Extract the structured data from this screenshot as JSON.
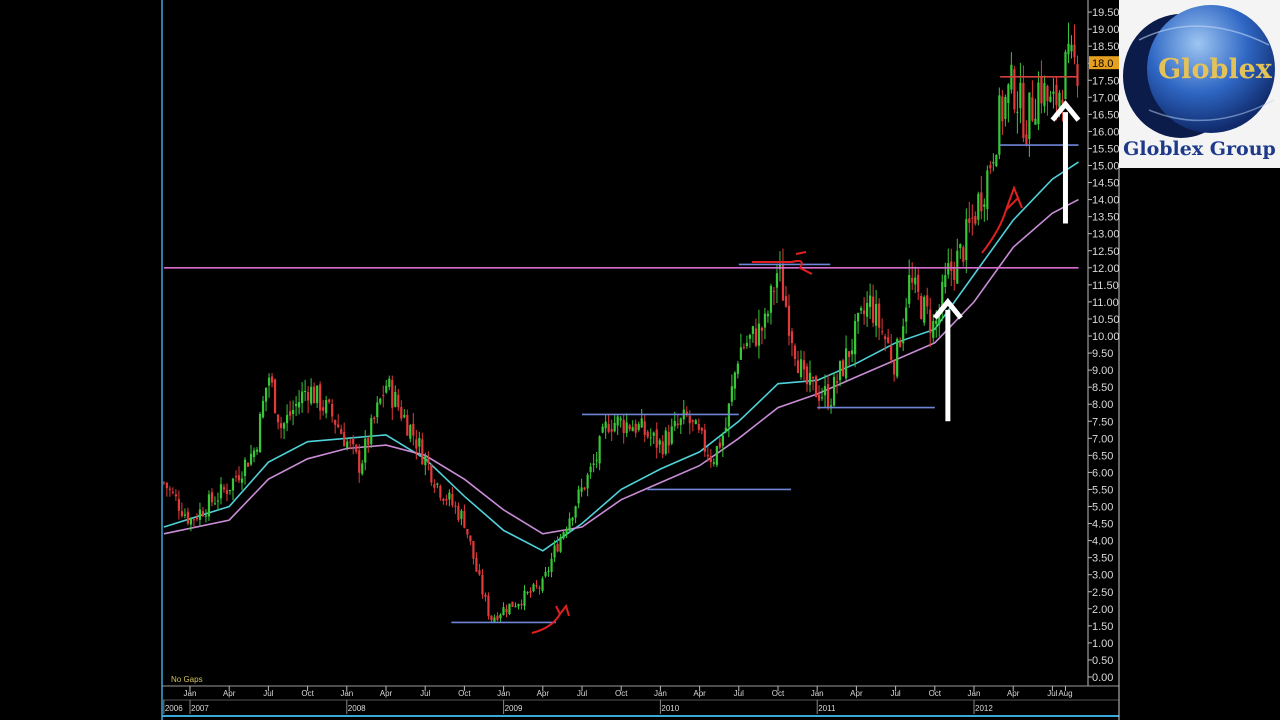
{
  "logo": {
    "brand_in_globe": "Globlex",
    "caption": "Globlex Group"
  },
  "status": {
    "no_gaps": "No Gaps"
  },
  "current_price_label": "18.0",
  "chart_data": {
    "type": "line",
    "title": "",
    "xlabel": "",
    "ylabel": "",
    "ylim": [
      0,
      19.5
    ],
    "y_ticks": [
      "0.00",
      "0.50",
      "1.00",
      "1.50",
      "2.00",
      "2.50",
      "3.00",
      "3.50",
      "4.00",
      "4.50",
      "5.00",
      "5.50",
      "6.00",
      "6.50",
      "7.00",
      "7.50",
      "8.00",
      "8.50",
      "9.00",
      "9.50",
      "10.00",
      "10.50",
      "11.00",
      "11.50",
      "12.00",
      "12.50",
      "13.00",
      "13.50",
      "14.00",
      "14.50",
      "15.00",
      "15.50",
      "16.00",
      "16.50",
      "17.00",
      "17.50",
      "18.00",
      "18.50",
      "19.00",
      "19.50"
    ],
    "month_ticks": [
      [
        "Jan",
        "2007-01"
      ],
      [
        "Apr",
        "2007-04"
      ],
      [
        "Jul",
        "2007-07"
      ],
      [
        "Oct",
        "2007-10"
      ],
      [
        "Jan",
        "2008-01"
      ],
      [
        "Apr",
        "2008-04"
      ],
      [
        "Jul",
        "2008-07"
      ],
      [
        "Oct",
        "2008-10"
      ],
      [
        "Jan",
        "2009-01"
      ],
      [
        "Apr",
        "2009-04"
      ],
      [
        "Jul",
        "2009-07"
      ],
      [
        "Oct",
        "2009-10"
      ],
      [
        "Jan",
        "2010-01"
      ],
      [
        "Apr",
        "2010-04"
      ],
      [
        "Jul",
        "2010-07"
      ],
      [
        "Oct",
        "2010-10"
      ],
      [
        "Jan",
        "2011-01"
      ],
      [
        "Apr",
        "2011-04"
      ],
      [
        "Jul",
        "2011-07"
      ],
      [
        "Oct",
        "2011-10"
      ],
      [
        "Jan",
        "2012-01"
      ],
      [
        "Apr",
        "2012-04"
      ],
      [
        "Jul",
        "2012-07"
      ],
      [
        "Aug",
        "2012-08"
      ]
    ],
    "year_ticks": [
      [
        "2006",
        "2006-11"
      ],
      [
        "2007",
        "2007-01"
      ],
      [
        "2008",
        "2008-01"
      ],
      [
        "2009",
        "2009-01"
      ],
      [
        "2010",
        "2010-01"
      ],
      [
        "2011",
        "2011-01"
      ],
      [
        "2012",
        "2012-01"
      ]
    ],
    "x_range": [
      "2006-11",
      "2012-09"
    ],
    "price_path": [
      [
        "2006-11",
        5.7
      ],
      [
        "2007-01",
        4.6
      ],
      [
        "2007-04",
        5.6
      ],
      [
        "2007-06",
        6.7
      ],
      [
        "2007-07",
        8.9
      ],
      [
        "2007-08",
        7.3
      ],
      [
        "2007-10",
        8.5
      ],
      [
        "2007-12",
        7.6
      ],
      [
        "2008-02",
        6.2
      ],
      [
        "2008-04",
        8.6
      ],
      [
        "2008-06",
        7.2
      ],
      [
        "2008-08",
        5.6
      ],
      [
        "2008-10",
        4.6
      ],
      [
        "2008-11",
        3.0
      ],
      [
        "2008-12",
        1.7
      ],
      [
        "2009-01",
        2.0
      ],
      [
        "2009-02",
        2.2
      ],
      [
        "2009-04",
        2.7
      ],
      [
        "2009-05",
        3.8
      ],
      [
        "2009-06",
        4.7
      ],
      [
        "2009-08",
        6.3
      ],
      [
        "2009-09",
        7.5
      ],
      [
        "2009-11",
        7.4
      ],
      [
        "2010-01",
        6.8
      ],
      [
        "2010-03",
        7.6
      ],
      [
        "2010-05",
        6.4
      ],
      [
        "2010-06",
        7.3
      ],
      [
        "2010-07",
        9.6
      ],
      [
        "2010-09",
        10.3
      ],
      [
        "2010-10",
        12.0
      ],
      [
        "2010-11",
        10.2
      ],
      [
        "2010-12",
        8.6
      ],
      [
        "2011-02",
        8.2
      ],
      [
        "2011-04",
        10.1
      ],
      [
        "2011-05",
        11.0
      ],
      [
        "2011-07",
        9.2
      ],
      [
        "2011-08",
        11.6
      ],
      [
        "2011-10",
        10.2
      ],
      [
        "2011-11",
        11.8
      ],
      [
        "2011-12",
        12.4
      ],
      [
        "2012-02",
        14.7
      ],
      [
        "2012-03",
        16.5
      ],
      [
        "2012-04",
        17.4
      ],
      [
        "2012-05",
        16.2
      ],
      [
        "2012-06",
        17.4
      ],
      [
        "2012-07",
        16.6
      ],
      [
        "2012-08",
        17.8
      ],
      [
        "2012-09",
        18.0
      ]
    ],
    "moving_averages": [
      {
        "color": "#4fd1d9",
        "points": [
          [
            "2006-11",
            4.4
          ],
          [
            "2007-04",
            5.0
          ],
          [
            "2007-07",
            6.3
          ],
          [
            "2007-10",
            6.9
          ],
          [
            "2008-01",
            7.0
          ],
          [
            "2008-04",
            7.1
          ],
          [
            "2008-07",
            6.4
          ],
          [
            "2008-10",
            5.3
          ],
          [
            "2009-01",
            4.3
          ],
          [
            "2009-04",
            3.7
          ],
          [
            "2009-07",
            4.5
          ],
          [
            "2009-10",
            5.5
          ],
          [
            "2010-01",
            6.1
          ],
          [
            "2010-04",
            6.6
          ],
          [
            "2010-07",
            7.5
          ],
          [
            "2010-10",
            8.6
          ],
          [
            "2011-01",
            8.7
          ],
          [
            "2011-04",
            9.2
          ],
          [
            "2011-07",
            9.8
          ],
          [
            "2011-10",
            10.2
          ],
          [
            "2012-01",
            11.8
          ],
          [
            "2012-04",
            13.4
          ],
          [
            "2012-07",
            14.6
          ],
          [
            "2012-09",
            15.1
          ]
        ]
      },
      {
        "color": "#c98cd6",
        "points": [
          [
            "2006-11",
            4.2
          ],
          [
            "2007-04",
            4.6
          ],
          [
            "2007-07",
            5.8
          ],
          [
            "2007-10",
            6.4
          ],
          [
            "2008-01",
            6.7
          ],
          [
            "2008-04",
            6.8
          ],
          [
            "2008-07",
            6.5
          ],
          [
            "2008-10",
            5.8
          ],
          [
            "2009-01",
            4.9
          ],
          [
            "2009-04",
            4.2
          ],
          [
            "2009-07",
            4.4
          ],
          [
            "2009-10",
            5.2
          ],
          [
            "2010-01",
            5.7
          ],
          [
            "2010-04",
            6.2
          ],
          [
            "2010-07",
            7.0
          ],
          [
            "2010-10",
            7.9
          ],
          [
            "2011-01",
            8.3
          ],
          [
            "2011-04",
            8.8
          ],
          [
            "2011-07",
            9.3
          ],
          [
            "2011-10",
            9.8
          ],
          [
            "2012-01",
            11.0
          ],
          [
            "2012-04",
            12.6
          ],
          [
            "2012-07",
            13.6
          ],
          [
            "2012-09",
            14.0
          ]
        ]
      }
    ],
    "annotations": {
      "horizontal_lines": [
        {
          "y": 12.0,
          "from": "2006-11",
          "to": "2012-09",
          "color": "#d86fd0",
          "note": "resistance line"
        },
        {
          "y": 1.6,
          "from": "2008-09",
          "to": "2009-05",
          "color": "#6f86d8"
        },
        {
          "y": 7.7,
          "from": "2009-07",
          "to": "2010-07",
          "color": "#6f86d8"
        },
        {
          "y": 5.5,
          "from": "2009-12",
          "to": "2010-11",
          "color": "#6f86d8"
        },
        {
          "y": 12.1,
          "from": "2010-07",
          "to": "2011-02",
          "color": "#6f86d8"
        },
        {
          "y": 7.9,
          "from": "2011-01",
          "to": "2011-10",
          "color": "#6f86d8"
        },
        {
          "y": 15.6,
          "from": "2012-03",
          "to": "2012-09",
          "color": "#6f86d8"
        },
        {
          "y": 17.6,
          "from": "2012-03",
          "to": "2012-09",
          "color": "#d24040"
        }
      ],
      "white_arrows": [
        {
          "x": "2011-11",
          "from_y": 7.5,
          "to_y": 11.0
        },
        {
          "x": "2012-08",
          "from_y": 13.3,
          "to_y": 16.8
        }
      ]
    }
  }
}
